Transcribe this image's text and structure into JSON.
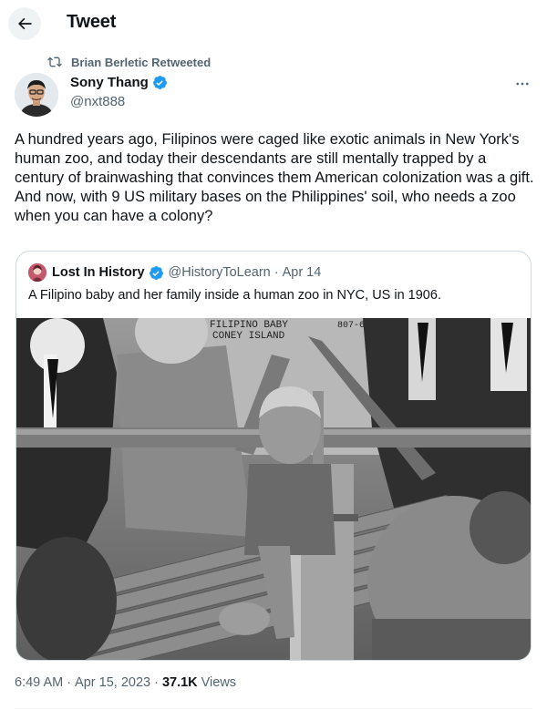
{
  "header": {
    "title": "Tweet"
  },
  "retweet": {
    "label": "Brian Berletic Retweeted"
  },
  "author": {
    "name": "Sony Thang",
    "handle": "@nxt888"
  },
  "tweet": {
    "paragraphs": [
      "A hundred years ago, Filipinos were caged like exotic animals in New York's human zoo, and today their descendants are still mentally trapped by a century of brainwashing that convinces them American colonization was a gift.",
      "And now, with 9 US military bases on the Philippines' soil, who needs a zoo when you can have a colony?"
    ]
  },
  "quote": {
    "name": "Lost In History",
    "handle": "@HistoryToLearn",
    "separator": "·",
    "date": "Apr 14",
    "text": "A Filipino baby and her family inside a human zoo in NYC, US in 1906.",
    "photo_caption_line1": "FILIPINO BABY",
    "photo_caption_line2": "CONEY ISLAND",
    "photo_number": "807-6"
  },
  "footer": {
    "time": "6:49 AM",
    "sep1": "·",
    "date": "Apr 15, 2023",
    "sep2": "·",
    "views_count": "37.1K",
    "views_label": "Views"
  },
  "icons": {
    "back": "back-arrow-icon",
    "retweet": "retweet-icon",
    "verified": "verified-badge-icon",
    "more": "more-icon"
  },
  "colors": {
    "verified": "#1d9bf0",
    "secondary_text": "#536471",
    "primary_text": "#0f1419",
    "border": "#cfd9de"
  }
}
